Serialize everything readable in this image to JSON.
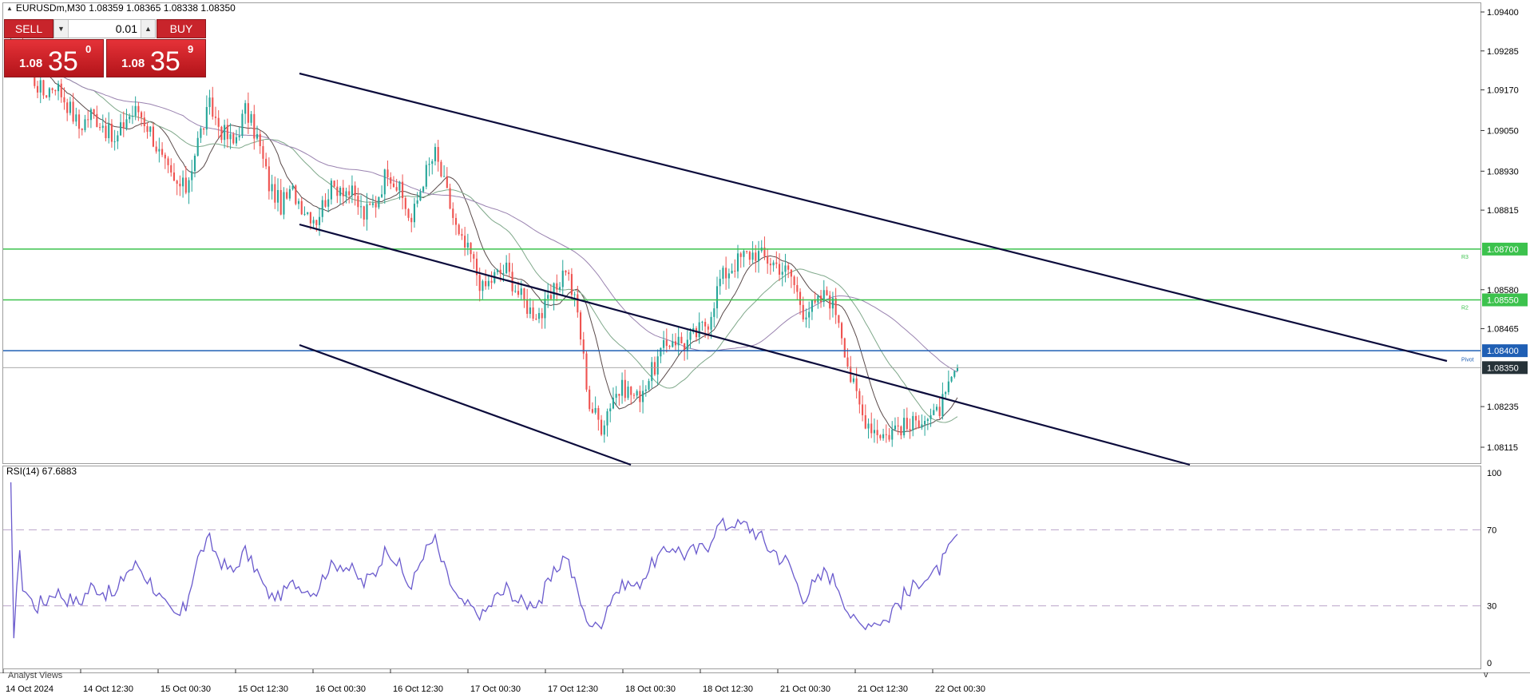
{
  "header": {
    "title": "EURUSDm,M30",
    "ohlc": "1.08359 1.08365 1.08338 1.08350"
  },
  "trade_panel": {
    "sell_label": "SELL",
    "buy_label": "BUY",
    "volume": "0.01",
    "sell_price": {
      "prefix": "1.08",
      "big": "35",
      "sup": "0"
    },
    "buy_price": {
      "prefix": "1.08",
      "big": "35",
      "sup": "9"
    }
  },
  "price_axis": {
    "ticks": [
      "1.09400",
      "1.09285",
      "1.09170",
      "1.09050",
      "1.08930",
      "1.08815",
      "1.08580",
      "1.08465",
      "1.08235",
      "1.08115"
    ],
    "tags": [
      {
        "label": "1.08700",
        "color": "#3cc24d"
      },
      {
        "label": "1.08550",
        "color": "#3cc24d"
      },
      {
        "label": "1.08400",
        "color": "#1f5fb4"
      },
      {
        "label": "1.08350",
        "color": "#263238"
      }
    ]
  },
  "level_labels": {
    "r3": "R3",
    "r2": "R2",
    "pivot": "Pivot"
  },
  "rsi": {
    "label": "RSI(14) 67.6883",
    "ticks": [
      "100",
      "70",
      "30",
      "0"
    ]
  },
  "time_axis": [
    "14 Oct 2024",
    "14 Oct 12:30",
    "15 Oct 00:30",
    "15 Oct 12:30",
    "16 Oct 00:30",
    "16 Oct 12:30",
    "17 Oct 00:30",
    "17 Oct 12:30",
    "18 Oct 00:30",
    "18 Oct 12:30",
    "21 Oct 00:30",
    "21 Oct 12:30",
    "22 Oct 00:30"
  ],
  "footer_tab": "Analyst Views",
  "colors": {
    "bull": "#26a69a",
    "bear": "#ef5350",
    "channel": "#0b0b3b",
    "ma_dark": "#5a4a4a",
    "ma_green": "#7fa88a",
    "ma_purple": "#9a83b0",
    "rsi_line": "#6a5acd",
    "resistance": "#3cc24d",
    "pivot": "#1f5fb4"
  },
  "chart_data": {
    "type": "candlestick",
    "symbol": "EURUSDm",
    "timeframe": "M30",
    "close": 1.0835,
    "ylim": [
      1.0808,
      1.0945
    ],
    "levels": [
      1.087,
      1.0855,
      1.084,
      1.0835
    ],
    "close_path": [
      1.0926,
      1.0928,
      1.0921,
      1.0916,
      1.0919,
      1.0913,
      1.0906,
      1.091,
      1.0907,
      1.0901,
      1.0909,
      1.0911,
      1.0905,
      1.0896,
      1.0889,
      1.0888,
      1.0902,
      1.0912,
      1.0905,
      1.0901,
      1.0911,
      1.0903,
      1.0889,
      1.0883,
      1.0887,
      1.0882,
      1.0879,
      1.0887,
      1.0889,
      1.0886,
      1.088,
      1.0884,
      1.0894,
      1.0887,
      1.0878,
      1.0891,
      1.0898,
      1.0886,
      1.0873,
      1.0868,
      1.0858,
      1.0862,
      1.0864,
      1.0857,
      1.0852,
      1.0851,
      1.0857,
      1.0865,
      1.0851,
      1.0824,
      1.0818,
      1.0827,
      1.0829,
      1.0826,
      1.0832,
      1.0839,
      1.0844,
      1.0842,
      1.0845,
      1.0849,
      1.0861,
      1.0865,
      1.0868,
      1.0869,
      1.0867,
      1.0865,
      1.0862,
      1.0852,
      1.0853,
      1.0857,
      1.085,
      1.0832,
      1.0821,
      1.0817,
      1.0815,
      1.0818,
      1.0817,
      1.0821,
      1.082,
      1.0826,
      1.0835
    ],
    "rsi": {
      "period": 14,
      "value": 67.6883,
      "levels": [
        70,
        30
      ],
      "ylim": [
        0,
        100
      ]
    }
  }
}
